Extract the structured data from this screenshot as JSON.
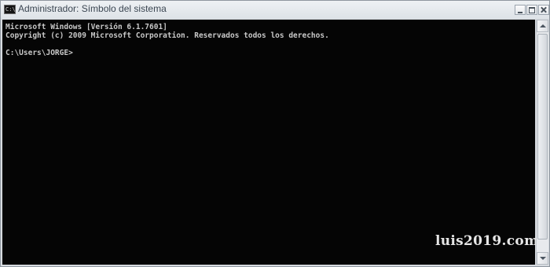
{
  "window": {
    "title": "Administrador: Símbolo del sistema",
    "icon": "cmd-icon",
    "icon_glyph": "C:\\"
  },
  "console": {
    "lines": [
      "Microsoft Windows [Versión 6.1.7601]",
      "Copyright (c) 2009 Microsoft Corporation. Reservados todos los derechos.",
      "C:\\Users\\JORGE>"
    ],
    "background_color": "#050505",
    "text_color": "#c8c8c8"
  },
  "watermark": {
    "text": "luis2019.com"
  },
  "controls": {
    "minimize_icon": "minimize-icon",
    "maximize_icon": "maximize-icon",
    "close_icon": "close-icon"
  }
}
